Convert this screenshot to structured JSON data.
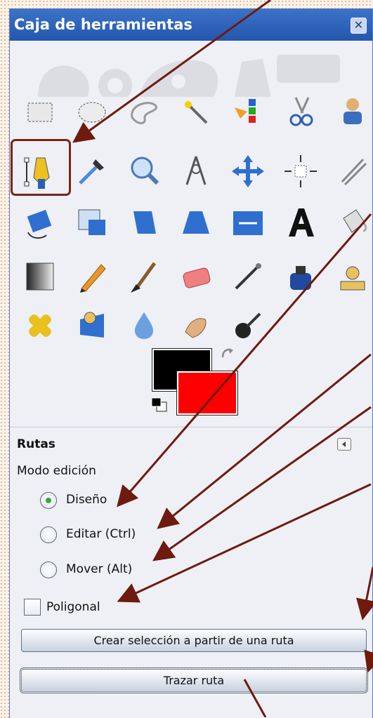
{
  "window": {
    "title": "Caja de herramientas",
    "close_label": "✕"
  },
  "tool_rows": [
    [
      "rect-select",
      "ellipse-select",
      "free-select",
      "fuzzy-select",
      "color-select",
      "scissors-select",
      "foreground-select"
    ],
    [
      "paths",
      "color-picker",
      "zoom",
      "measure",
      "move",
      "align",
      "crop"
    ],
    [
      "rotate",
      "scale",
      "shear",
      "perspective",
      "flip",
      "text",
      "bucket-fill"
    ],
    [
      "blend",
      "pencil",
      "paintbrush",
      "eraser",
      "airbrush",
      "ink",
      "clone"
    ],
    [
      "heal",
      "perspective-clone",
      "blur",
      "smudge",
      "dodge-burn"
    ]
  ],
  "active_tool": "paths",
  "colors": {
    "foreground": "#000000",
    "background": "#ff0000",
    "arrow": "#6e1a0e"
  },
  "options": {
    "title": "Rutas",
    "mode_label": "Modo edición",
    "modes": [
      {
        "label": "Diseño",
        "checked": true
      },
      {
        "label": "Editar (Ctrl)",
        "checked": false
      },
      {
        "label": "Mover (Alt)",
        "checked": false
      }
    ],
    "polygonal_label": "Poligonal",
    "polygonal_checked": false,
    "selection_button": "Crear selección a partir de una ruta",
    "trace_button": "Trazar ruta"
  }
}
